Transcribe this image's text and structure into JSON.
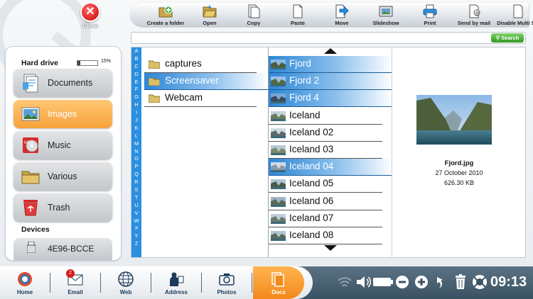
{
  "close": {
    "label": "Close"
  },
  "toolbar": {
    "items": [
      {
        "label": "Create a folder",
        "icon": "create-folder-icon"
      },
      {
        "label": "Open",
        "icon": "open-folder-icon"
      },
      {
        "label": "Copy",
        "icon": "copy-icon"
      },
      {
        "label": "Paste",
        "icon": "paste-icon"
      },
      {
        "label": "Move",
        "icon": "move-icon"
      },
      {
        "label": "Slideshow",
        "icon": "slideshow-icon"
      },
      {
        "label": "Print",
        "icon": "printer-icon"
      },
      {
        "label": "Send by mail",
        "icon": "send-mail-icon"
      },
      {
        "label": "Disable Multi Sel",
        "icon": "multi-select-icon"
      }
    ]
  },
  "search": {
    "button": "Search",
    "value": ""
  },
  "storage": {
    "label": "Hard drive",
    "percent": "15%",
    "fill": 0.15
  },
  "categories": [
    {
      "label": "Documents",
      "icon": "documents-icon",
      "active": false
    },
    {
      "label": "Images",
      "icon": "images-icon",
      "active": true
    },
    {
      "label": "Music",
      "icon": "music-icon",
      "active": false
    },
    {
      "label": "Various",
      "icon": "various-folder-icon",
      "active": false
    },
    {
      "label": "Trash",
      "icon": "trash-icon",
      "active": false
    }
  ],
  "devices": {
    "label": "Devices",
    "items": [
      {
        "label": "4E96-BCCE"
      }
    ]
  },
  "alphabet": [
    "A",
    "B",
    "C",
    "D",
    "E",
    "F",
    "G",
    "H",
    "I",
    "J",
    "K",
    "L",
    "M",
    "N",
    "O",
    "P",
    "Q",
    "R",
    "S",
    "T",
    "U",
    "V",
    "W",
    "X",
    "Y",
    "Z"
  ],
  "folders": [
    {
      "label": "captures",
      "selected": false
    },
    {
      "label": "Screensaver",
      "selected": true
    },
    {
      "label": "Webcam",
      "selected": false
    }
  ],
  "files": [
    {
      "label": "Fjord",
      "selected": true
    },
    {
      "label": "Fjord 2",
      "selected": true
    },
    {
      "label": "Fjord 4",
      "selected": true
    },
    {
      "label": "Iceland",
      "selected": false
    },
    {
      "label": "Iceland 02",
      "selected": false
    },
    {
      "label": "Iceland 03",
      "selected": false
    },
    {
      "label": "Iceland 04",
      "selected": true
    },
    {
      "label": "Iceland 05",
      "selected": false
    },
    {
      "label": "Iceland 06",
      "selected": false
    },
    {
      "label": "Iceland 07",
      "selected": false
    },
    {
      "label": "Iceland 08",
      "selected": false
    }
  ],
  "preview": {
    "name": "Fjord.jpg",
    "date": "27 October 2010",
    "size": "626.30 KB"
  },
  "taskbar": {
    "items": [
      {
        "label": "Home",
        "icon": "home-icon",
        "active": false
      },
      {
        "label": "Email",
        "icon": "email-icon",
        "active": false,
        "badge": "2"
      },
      {
        "label": "Web",
        "icon": "web-globe-icon",
        "active": false
      },
      {
        "label": "Address",
        "icon": "address-book-icon",
        "active": false
      },
      {
        "label": "Photos",
        "icon": "camera-icon",
        "active": false
      },
      {
        "label": "Docs",
        "icon": "docs-icon",
        "active": true
      }
    ],
    "clock": "09:13"
  },
  "colors": {
    "accent": "#2a8fe0",
    "active_orange": "#f7a23b",
    "taskbar": "#4a6272"
  }
}
